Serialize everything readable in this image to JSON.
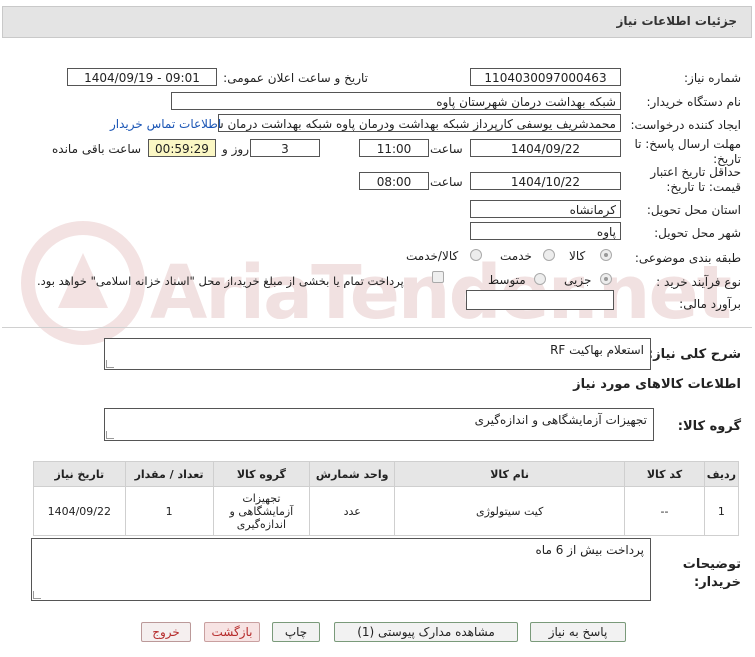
{
  "header": {
    "title": "جزئیات اطلاعات نیاز"
  },
  "fields": {
    "need_number_label": "شماره نیاز:",
    "need_number": "1104030097000463",
    "announce_label": "تاریخ و ساعت اعلان عمومی:",
    "announce_value": "1404/09/19 - 09:01",
    "buyer_org_label": "نام دستگاه خریدار:",
    "buyer_org": "شبکه بهداشت درمان شهرستان پاوه",
    "creator_label": "ایجاد کننده درخواست:",
    "creator": "محمدشریف یوسفی کارپرداز شبکه بهداشت ودرمان پاوه شبکه بهداشت درمان ش",
    "contact_link": "اطلاعات تماس خریدار",
    "reply_deadline_label": "مهلت ارسال پاسخ: تا تاریخ:",
    "reply_date": "1404/09/22",
    "time_word": "ساعت",
    "reply_time": "11:00",
    "days_value": "3",
    "days_and": "روز و",
    "remaining_time": "00:59:29",
    "remaining_label": "ساعت باقی مانده",
    "validity_label": "حداقل تاریخ اعتبار قیمت: تا تاریخ:",
    "validity_date": "1404/10/22",
    "validity_time": "08:00",
    "province_label": "استان محل تحویل:",
    "province": "کرمانشاه",
    "city_label": "شهر محل تحویل:",
    "city": "پاوه",
    "category_label": "طبقه بندی موضوعی:",
    "category_options": [
      "کالا",
      "خدمت",
      "کالا/خدمت"
    ],
    "process_label": "نوع فرآیند خرید :",
    "process_options": [
      "جزیی",
      "متوسط"
    ],
    "treasury_note": "پرداخت تمام یا بخشی از مبلغ خرید،از محل \"اسناد خزانه اسلامی\" خواهد بود.",
    "estimate_label": "برآورد مالی:",
    "estimate_value": ""
  },
  "description": {
    "label": "شرح کلی نیاز:",
    "value": "استعلام بهاکیت RF"
  },
  "goods_info": {
    "title": "اطلاعات کالاهای مورد نیاز",
    "group_label": "گروه کالا:",
    "group_value": "تجهیزات آزمایشگاهی و اندازه‌گیری"
  },
  "table": {
    "headers": [
      "ردیف",
      "کد کالا",
      "نام کالا",
      "واحد شمارش",
      "گروه کالا",
      "تعداد / مقدار",
      "تاریخ نیاز"
    ],
    "rows": [
      [
        "1",
        "--",
        "کیت سیتولوژی",
        "عدد",
        "تجهیزات آزمایشگاهی و اندازه‌گیری",
        "1",
        "1404/09/22"
      ]
    ]
  },
  "buyer_notes": {
    "label": "توضیحات خریدار:",
    "value": "پرداخت بیش از 6 ماه"
  },
  "buttons": {
    "reply": "پاسخ به نیاز",
    "attachments": "مشاهده مدارک پیوستی (1)",
    "print": "چاپ",
    "back": "بازگشت",
    "exit": "خروج"
  },
  "watermark": "AriaTender.net",
  "colors": {
    "highlight": "#fbf7c4",
    "link": "#1a55b5",
    "exit": "#b52a2a"
  }
}
